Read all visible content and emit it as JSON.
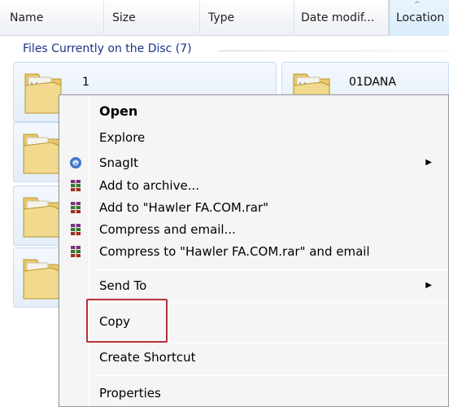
{
  "columns": {
    "name": "Name",
    "size": "Size",
    "type": "Type",
    "date": "Date modif...",
    "location": "Location"
  },
  "group": {
    "title": "Files Currently on the Disc (7)"
  },
  "files": [
    {
      "name": "1"
    },
    {
      "name": "01DANA"
    }
  ],
  "context_menu": {
    "items": [
      {
        "label": "Open"
      },
      {
        "label": "Explore"
      },
      {
        "label": "SnagIt",
        "icon": "snagit-icon"
      },
      {
        "label": "Add to archive...",
        "icon": "winrar-icon"
      },
      {
        "label": "Add to \"Hawler FA.COM.rar\"",
        "icon": "winrar-icon"
      },
      {
        "label": "Compress and email...",
        "icon": "winrar-icon"
      },
      {
        "label": "Compress to \"Hawler FA.COM.rar\" and email",
        "icon": "winrar-icon"
      },
      {
        "label": "Send To"
      },
      {
        "label": "Copy"
      },
      {
        "label": "Create Shortcut"
      },
      {
        "label": "Properties"
      }
    ]
  },
  "colors": {
    "highlight_border": "#b8323a",
    "group_title": "#1e3287"
  }
}
